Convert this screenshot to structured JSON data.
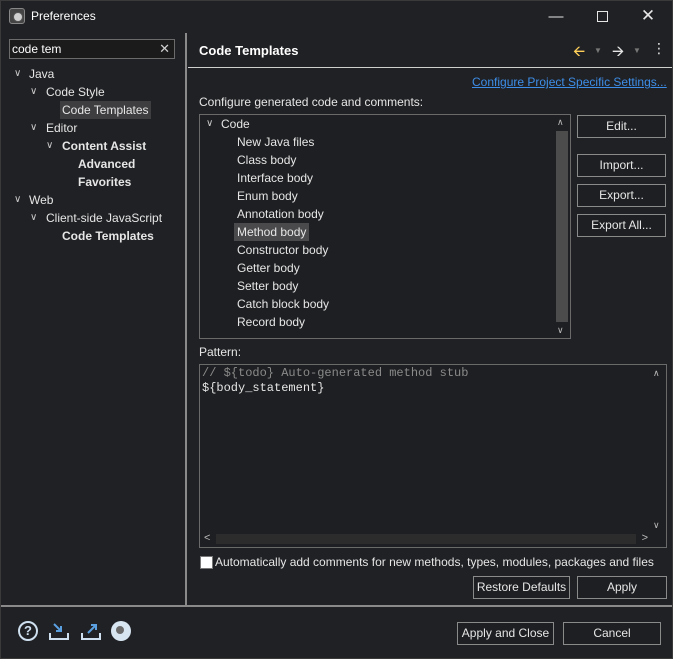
{
  "window": {
    "title": "Preferences",
    "minimize_glyph": "—",
    "close_glyph": "✕"
  },
  "filter": {
    "value": "code tem",
    "clear_glyph": "✕"
  },
  "tree": {
    "java": "Java",
    "code_style": "Code Style",
    "code_templates": "Code Templates",
    "editor": "Editor",
    "content_assist": "Content Assist",
    "advanced": "Advanced",
    "favorites": "Favorites",
    "web": "Web",
    "client_js": "Client-side JavaScript",
    "web_code_templates": "Code Templates"
  },
  "page": {
    "title": "Code Templates",
    "configure_link": "Configure Project Specific Settings...",
    "description": "Configure generated code and comments:"
  },
  "templates": {
    "root": "Code",
    "items": [
      "New Java files",
      "Class body",
      "Interface body",
      "Enum body",
      "Annotation body",
      "Method body",
      "Constructor body",
      "Getter body",
      "Setter body",
      "Catch block body",
      "Record body"
    ],
    "selected": "Method body"
  },
  "buttons": {
    "edit": "Edit...",
    "import": "Import...",
    "export": "Export...",
    "export_all": "Export All...",
    "restore_defaults": "Restore Defaults",
    "apply": "Apply",
    "apply_close": "Apply and Close",
    "cancel": "Cancel"
  },
  "pattern": {
    "label": "Pattern:",
    "line1": "// ${todo} Auto-generated method stub",
    "line2": "${body_statement}"
  },
  "auto_comments": {
    "checked": false,
    "label": "Automatically add comments for new methods, types, modules, packages and files"
  },
  "icons": {
    "app": "preferences-gear-icon",
    "help": "help-icon",
    "import": "import-preferences-icon",
    "export": "export-preferences-icon",
    "record": "record-icon"
  },
  "colors": {
    "background": "#202124",
    "link": "#3d8ee8",
    "back_arrow": "#ffcf5a",
    "selection": "#4a4a4c"
  }
}
